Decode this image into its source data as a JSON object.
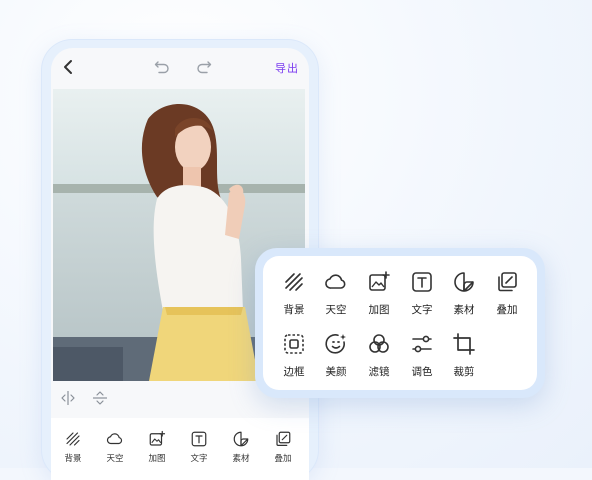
{
  "topbar": {
    "back_icon": "chevron-left-icon",
    "undo_icon": "undo-icon",
    "redo_icon": "redo-icon",
    "export_label": "导出",
    "export_color": "#7b3cf0"
  },
  "photo": {
    "description_icon": "photo-image",
    "colors": {
      "sky": "#dfe9ea",
      "sea": "#c9d6d8",
      "hair": "#6b3a24",
      "shirt": "#f4f2ef",
      "skirt": "#f0d67a"
    }
  },
  "compare_bar": {
    "split_icon": "split-compare-icon",
    "vertical_icon": "vertical-compare-icon"
  },
  "bottom_tools": [
    {
      "label": "背景",
      "icon": "background-hatch-icon"
    },
    {
      "label": "天空",
      "icon": "cloud-icon"
    },
    {
      "label": "加图",
      "icon": "add-image-icon"
    },
    {
      "label": "文字",
      "icon": "text-icon"
    },
    {
      "label": "素材",
      "icon": "sticker-icon"
    },
    {
      "label": "叠加",
      "icon": "overlay-icon"
    }
  ],
  "panel_tools": [
    {
      "label": "背景",
      "icon": "background-hatch-icon"
    },
    {
      "label": "天空",
      "icon": "cloud-icon"
    },
    {
      "label": "加图",
      "icon": "add-image-icon"
    },
    {
      "label": "文字",
      "icon": "text-icon"
    },
    {
      "label": "素材",
      "icon": "sticker-icon"
    },
    {
      "label": "叠加",
      "icon": "overlay-icon"
    },
    {
      "label": "边框",
      "icon": "frame-icon"
    },
    {
      "label": "美颜",
      "icon": "beauty-face-icon"
    },
    {
      "label": "滤镜",
      "icon": "filter-icon"
    },
    {
      "label": "调色",
      "icon": "adjust-sliders-icon"
    },
    {
      "label": "裁剪",
      "icon": "crop-icon"
    }
  ]
}
